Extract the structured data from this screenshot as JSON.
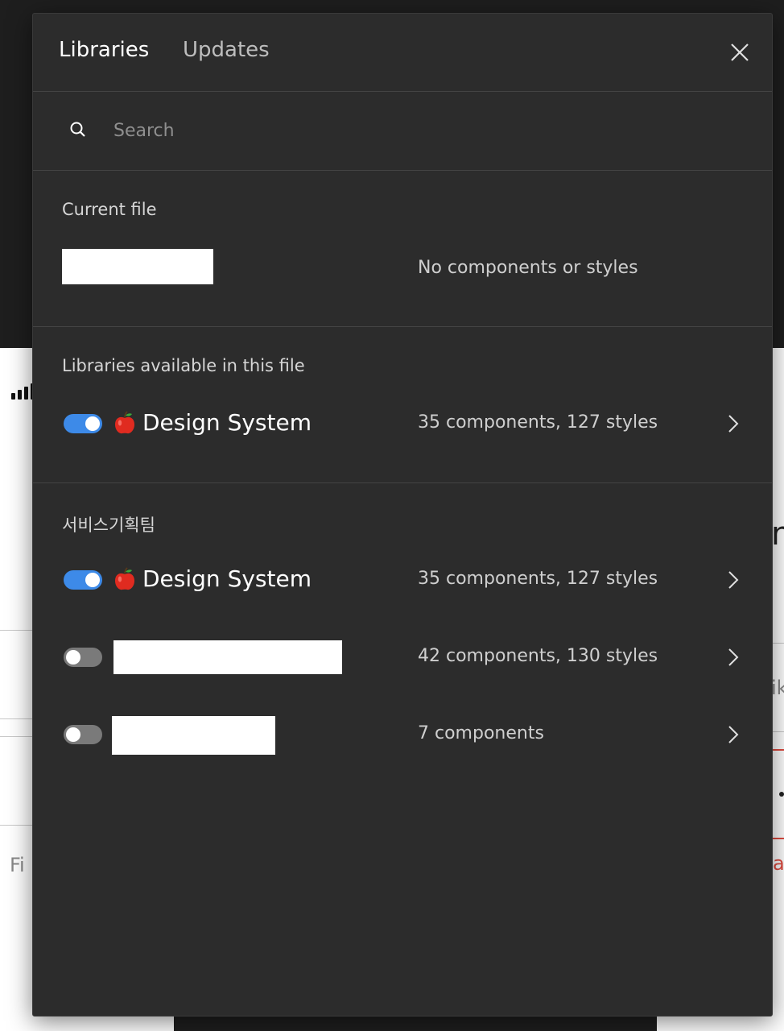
{
  "background": {
    "left_fragment": "Fi",
    "right_fragment_1": "n",
    "right_fragment_2": "ik",
    "right_fragment_3": "a"
  },
  "dialog": {
    "tabs": {
      "libraries": "Libraries",
      "updates": "Updates"
    },
    "close_icon": "close-icon",
    "search": {
      "placeholder": "Search",
      "value": ""
    },
    "current_file": {
      "title": "Current file",
      "status": "No components or styles"
    },
    "available": {
      "title": "Libraries available in this file",
      "items": [
        {
          "emoji": "🍎",
          "name": "Design System",
          "enabled": true,
          "count": "35 components, 127 styles"
        }
      ]
    },
    "team": {
      "title": "서비스기획팀",
      "items": [
        {
          "emoji": "🍎",
          "name": "Design System",
          "enabled": true,
          "count": "35 components, 127 styles"
        },
        {
          "name": "",
          "enabled": false,
          "count": "42 components, 130 styles"
        },
        {
          "name": "",
          "enabled": false,
          "count": "7 components"
        }
      ]
    }
  },
  "colors": {
    "accent": "#3d8ae8",
    "panel": "#2c2c2c",
    "divider": "#444444"
  }
}
